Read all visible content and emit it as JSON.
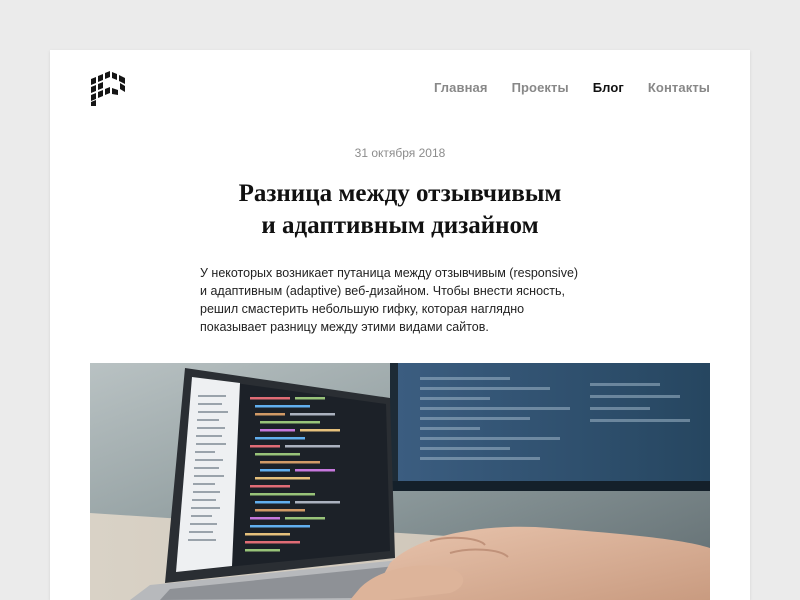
{
  "header": {
    "logo_icon": "pixel-p-logo-icon",
    "nav": [
      {
        "label": "Главная",
        "active": false
      },
      {
        "label": "Проекты",
        "active": false
      },
      {
        "label": "Блог",
        "active": true
      },
      {
        "label": "Контакты",
        "active": false
      }
    ]
  },
  "post": {
    "date": "31 октября 2018",
    "title_line1": "Разница между отзывчивым",
    "title_line2": "и адаптивным дизайном",
    "lead": "У некоторых возникает путаница между отзывчивым (responsive) и адаптивным (adaptive) веб-дизайном. Чтобы внести ясность, решил смастерить небольшую гифку, которая наглядно показывает разницу между этими видами сайтов."
  },
  "hero_image": {
    "subject": "laptop-with-code-photo"
  },
  "colors": {
    "page_bg": "#ebebeb",
    "card_bg": "#ffffff",
    "nav_inactive": "#888888",
    "nav_active": "#111111",
    "date": "#8c8c8c"
  }
}
